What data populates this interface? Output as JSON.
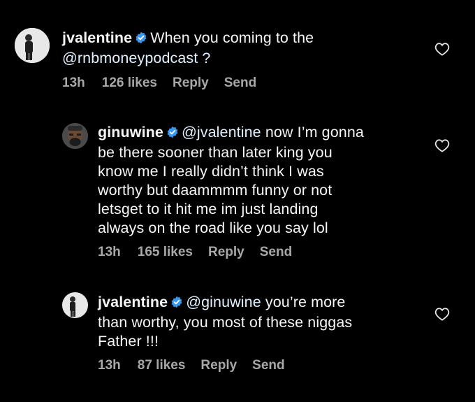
{
  "colors": {
    "background": "#000000",
    "text": "#f5f5f5",
    "meta": "#a8a8a8",
    "verified_badge": "#3897f0"
  },
  "comments": [
    {
      "username": "jvalentine",
      "verified": true,
      "mention": "",
      "text_line1": "When you coming to the",
      "text_rest": [
        "@rnbmoneypodcast ?"
      ],
      "time": "13h",
      "likes": "126 likes",
      "reply_label": "Reply",
      "send_label": "Send",
      "like_icon": "heart-outline-icon"
    },
    {
      "username": "ginuwine",
      "verified": true,
      "mention": "@jvalentine",
      "text_line1": "now I’m gonna",
      "text_rest": [
        "be there sooner than later king you",
        "know me I really didn’t think I was",
        "worthy but daammmm funny or not",
        "letsget to it hit me im just landing",
        "always on the road like you say lol"
      ],
      "time": "13h",
      "likes": "165 likes",
      "reply_label": "Reply",
      "send_label": "Send",
      "like_icon": "heart-outline-icon"
    },
    {
      "username": "jvalentine",
      "verified": true,
      "mention": "@ginuwine",
      "text_line1": "you’re more",
      "text_rest": [
        "than worthy, you most of these niggas",
        "Father !!!"
      ],
      "time": "13h",
      "likes": "87 likes",
      "reply_label": "Reply",
      "send_label": "Send",
      "like_icon": "heart-outline-icon"
    }
  ]
}
